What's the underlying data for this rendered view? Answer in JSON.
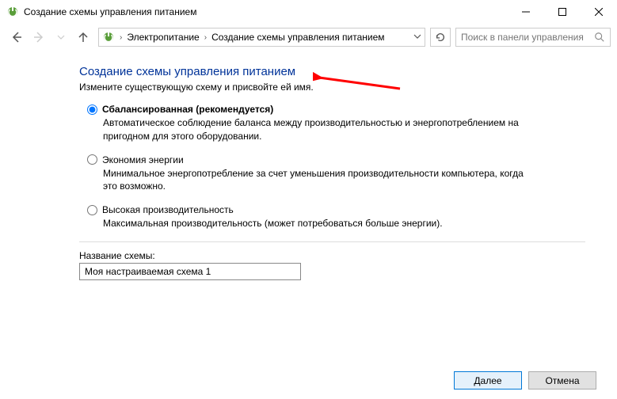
{
  "window": {
    "title": "Создание схемы управления питанием"
  },
  "breadcrumb": {
    "item1": "Электропитание",
    "item2": "Создание схемы управления питанием"
  },
  "search": {
    "placeholder": "Поиск в панели управления"
  },
  "page": {
    "title": "Создание схемы управления питанием",
    "subtitle": "Измените существующую схему и присвойте ей имя."
  },
  "plans": {
    "balanced": {
      "label": "Сбалансированная (рекомендуется)",
      "desc": "Автоматическое соблюдение баланса между производительностью и энергопотреблением на пригодном для этого оборудовании."
    },
    "saver": {
      "label": "Экономия энергии",
      "desc": "Минимальное энергопотребление за счет уменьшения производительности компьютера, когда это возможно."
    },
    "high": {
      "label": "Высокая производительность",
      "desc": "Максимальная производительность (может потребоваться больше энергии)."
    }
  },
  "nameField": {
    "label": "Название схемы:",
    "value": "Моя настраиваемая схема 1"
  },
  "buttons": {
    "next": "Далее",
    "cancel": "Отмена"
  }
}
